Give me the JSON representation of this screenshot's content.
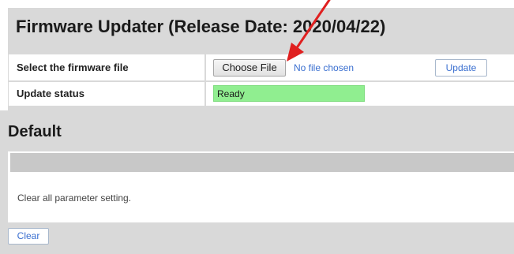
{
  "firmware": {
    "title": "Firmware Updater (Release Date: 2020/04/22)",
    "file_row": {
      "label": "Select the firmware file",
      "choose_button": "Choose File",
      "file_status": "No file chosen",
      "update_button": "Update"
    },
    "status_row": {
      "label": "Update status",
      "value": "Ready"
    }
  },
  "default": {
    "title": "Default",
    "description": "Clear all parameter setting.",
    "clear_button": "Clear"
  },
  "colors": {
    "section_bg": "#d9d9d9",
    "status_ok": "#90ee90",
    "link_blue": "#3a6fd0",
    "annotation_arrow": "#e02020"
  },
  "annotation": {
    "icon": "red-arrow-icon"
  }
}
